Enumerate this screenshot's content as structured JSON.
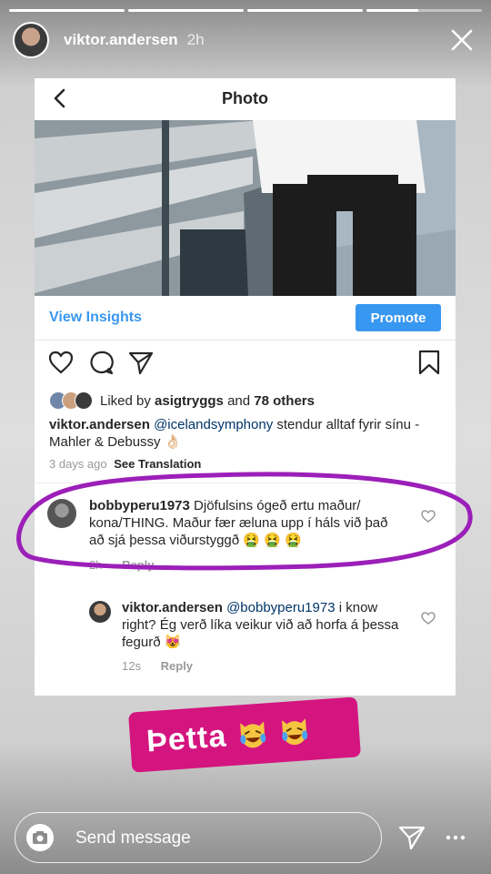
{
  "story": {
    "username": "viktor.andersen",
    "time": "2h",
    "progress": [
      1,
      1,
      1,
      0.45
    ],
    "reply_placeholder": "Send message"
  },
  "post": {
    "page_title": "Photo",
    "view_insights_label": "View Insights",
    "promote_label": "Promote",
    "likes": {
      "prefix": "Liked by",
      "user": "asigtryggs",
      "middle": "and",
      "others": "78 others"
    },
    "caption": {
      "user": "viktor.andersen",
      "mention": "@icelandsymphony",
      "text": "stendur alltaf fyrir sínu - Mahler & Debussy 👌🏻"
    },
    "age": "3 days ago",
    "see_translation": "See Translation"
  },
  "comments": [
    {
      "user": "bobbyperu1973",
      "text": "Djöfulsins ógeð ertu maður/ kona/THING. Maður fær æluna upp í háls við það að sjá þessa viðurstyggð 🤮 🤮 🤮",
      "time": "2h",
      "reply": "Reply"
    },
    {
      "user": "viktor.andersen",
      "mention": "@bobbyperu1973",
      "text": "i know right? Ég verð líka veikur við að horfa á þessa fegurð 😻",
      "time": "12s",
      "reply": "Reply"
    }
  ],
  "sticker": {
    "text": "Þetta"
  },
  "colors": {
    "accent_blue": "#3897f0",
    "highlight_purple": "#9b1fb8",
    "sticker_pink": "#d4157f"
  },
  "icons": [
    "close-icon",
    "back-icon",
    "heart-icon",
    "comment-icon",
    "share-icon",
    "bookmark-icon",
    "camera-icon",
    "direct-send-icon",
    "more-icon",
    "crying-laughing-cat-emoji"
  ]
}
